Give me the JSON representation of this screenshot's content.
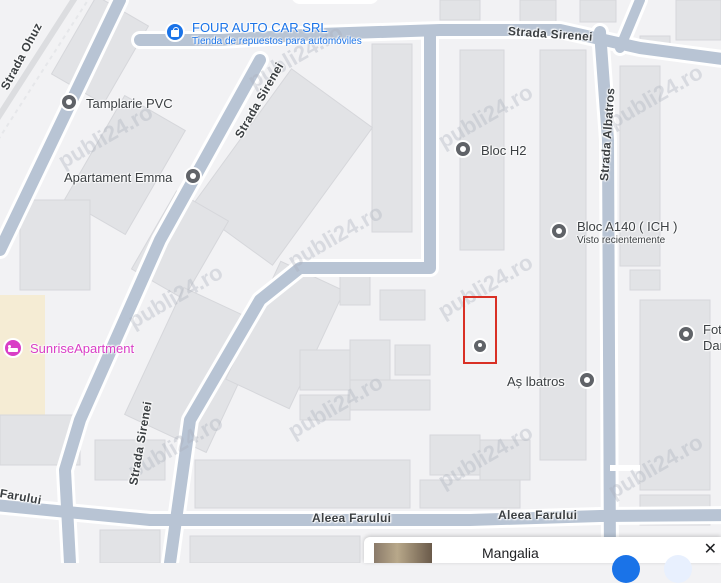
{
  "map": {
    "background": "#f2f2f4",
    "road_color": "#b8c4d4",
    "road_casing": "#ffffff",
    "building_color": "#e2e3e6",
    "sand_color": "#f5ecd4"
  },
  "streets": {
    "sirenei_top": "Strada Sirenei",
    "sirenei_diag": "Strada Sirenei",
    "sirenei_left": "Strada Sirenei",
    "albatros": "Strada Albatros",
    "farului_center": "Aleea Farului",
    "farului_right": "Aleea Farului",
    "farului_left": "Farului",
    "ohuz": "Strada Ohuz"
  },
  "pois": {
    "four_auto": {
      "name": "FOUR AUTO CAR SRL",
      "subtitle": "Tienda de repuestos para automóviles",
      "color": "#1a73e8",
      "icon": "shopping-bag-icon"
    },
    "tamplarie": {
      "name": "Tamplarie PVC",
      "icon": "place-icon"
    },
    "apartament_emma": {
      "name": "Apartament Emma",
      "icon": "place-icon"
    },
    "bloc_h2": {
      "name": "Bloc H2",
      "icon": "place-icon"
    },
    "bloc_a140": {
      "name": "Bloc A140 ( ICH )",
      "subtitle": "Visto recientemente",
      "icon": "place-icon"
    },
    "albatros": {
      "name": "Aș lbatros",
      "icon": "place-icon"
    },
    "sunrise": {
      "name": "SunriseApartment",
      "color": "#d93ec6",
      "icon": "bed-icon"
    },
    "fot": {
      "name_line1": "Fot",
      "name_line2": "Dar",
      "icon": "place-icon"
    }
  },
  "highlight": {
    "color": "#d93025",
    "icon": "dropped-pin-icon"
  },
  "watermark": "publi24.ro",
  "bottom_card": {
    "title": "Mangalia",
    "close_symbol": "✕"
  }
}
